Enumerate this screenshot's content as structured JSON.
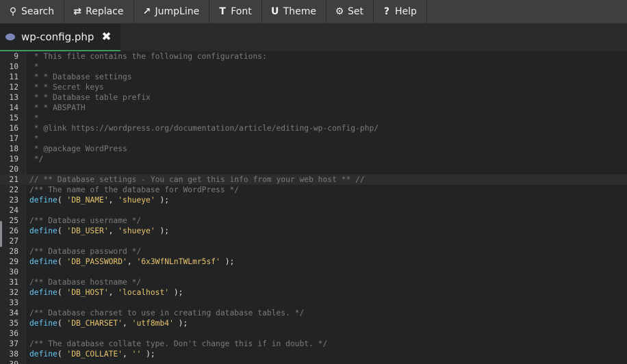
{
  "toolbar": [
    {
      "id": "search",
      "label": "Search",
      "icon": "search-icon",
      "glyph": "⚲"
    },
    {
      "id": "replace",
      "label": "Replace",
      "icon": "replace-icon",
      "glyph": "⇄"
    },
    {
      "id": "jumpline",
      "label": "JumpLine",
      "icon": "jump-icon",
      "glyph": "↗"
    },
    {
      "id": "font",
      "label": "Font",
      "icon": "font-icon",
      "glyph": "T"
    },
    {
      "id": "theme",
      "label": "Theme",
      "icon": "theme-icon",
      "glyph": "U"
    },
    {
      "id": "set",
      "label": "Set",
      "icon": "gear-icon",
      "glyph": "⚙"
    },
    {
      "id": "help",
      "label": "Help",
      "icon": "help-icon",
      "glyph": "?"
    }
  ],
  "tab": {
    "filename": "wp-config.php",
    "close_glyph": "✖"
  },
  "colors": {
    "accent": "#3f9b5a",
    "keyword": "#67c8f3",
    "string": "#e8c56b",
    "comment": "#7c7c7c"
  },
  "editor": {
    "active_line": 21,
    "lines": [
      {
        "n": "9",
        "parts": [
          {
            "t": " * This file contains the following configurations:",
            "c": "cm"
          }
        ]
      },
      {
        "n": "10",
        "parts": [
          {
            "t": " *",
            "c": "cm"
          }
        ]
      },
      {
        "n": "11",
        "parts": [
          {
            "t": " * * Database settings",
            "c": "cm"
          }
        ]
      },
      {
        "n": "12",
        "parts": [
          {
            "t": " * * Secret keys",
            "c": "cm"
          }
        ]
      },
      {
        "n": "13",
        "parts": [
          {
            "t": " * * Database table prefix",
            "c": "cm"
          }
        ]
      },
      {
        "n": "14",
        "parts": [
          {
            "t": " * * ABSPATH",
            "c": "cm"
          }
        ]
      },
      {
        "n": "15",
        "parts": [
          {
            "t": " *",
            "c": "cm"
          }
        ]
      },
      {
        "n": "16",
        "parts": [
          {
            "t": " * @link https://wordpress.org/documentation/article/editing-wp-config-php/",
            "c": "cm"
          }
        ]
      },
      {
        "n": "17",
        "parts": [
          {
            "t": " *",
            "c": "cm"
          }
        ]
      },
      {
        "n": "18",
        "parts": [
          {
            "t": " * @package WordPress",
            "c": "cm"
          }
        ]
      },
      {
        "n": "19",
        "parts": [
          {
            "t": " */",
            "c": "cm"
          }
        ]
      },
      {
        "n": "20",
        "parts": []
      },
      {
        "n": "21",
        "parts": [
          {
            "t": "// ** Database settings - You can get this info from your web host ** //",
            "c": "cm"
          }
        ]
      },
      {
        "n": "22",
        "parts": [
          {
            "t": "/** The name of the database for WordPress */",
            "c": "cm"
          }
        ]
      },
      {
        "n": "23",
        "parts": [
          {
            "t": "define",
            "c": "kw"
          },
          {
            "t": "( ",
            "c": "pn"
          },
          {
            "t": "'DB_NAME'",
            "c": "st"
          },
          {
            "t": ", ",
            "c": "pn"
          },
          {
            "t": "'shueye'",
            "c": "st"
          },
          {
            "t": " );",
            "c": "pn"
          }
        ]
      },
      {
        "n": "24",
        "parts": []
      },
      {
        "n": "25",
        "parts": [
          {
            "t": "/** Database username */",
            "c": "cm"
          }
        ]
      },
      {
        "n": "26",
        "parts": [
          {
            "t": "define",
            "c": "kw"
          },
          {
            "t": "( ",
            "c": "pn"
          },
          {
            "t": "'DB_USER'",
            "c": "st"
          },
          {
            "t": ", ",
            "c": "pn"
          },
          {
            "t": "'shueye'",
            "c": "st"
          },
          {
            "t": " );",
            "c": "pn"
          }
        ]
      },
      {
        "n": "27",
        "parts": []
      },
      {
        "n": "28",
        "parts": [
          {
            "t": "/** Database password */",
            "c": "cm"
          }
        ]
      },
      {
        "n": "29",
        "parts": [
          {
            "t": "define",
            "c": "kw"
          },
          {
            "t": "( ",
            "c": "pn"
          },
          {
            "t": "'DB_PASSWORD'",
            "c": "st"
          },
          {
            "t": ", ",
            "c": "pn"
          },
          {
            "t": "'6x3WfNLnTWLmr5sf'",
            "c": "st"
          },
          {
            "t": " );",
            "c": "pn"
          }
        ]
      },
      {
        "n": "30",
        "parts": []
      },
      {
        "n": "31",
        "parts": [
          {
            "t": "/** Database hostname */",
            "c": "cm"
          }
        ]
      },
      {
        "n": "32",
        "parts": [
          {
            "t": "define",
            "c": "kw"
          },
          {
            "t": "( ",
            "c": "pn"
          },
          {
            "t": "'DB_HOST'",
            "c": "st"
          },
          {
            "t": ", ",
            "c": "pn"
          },
          {
            "t": "'localhost'",
            "c": "st"
          },
          {
            "t": " );",
            "c": "pn"
          }
        ]
      },
      {
        "n": "33",
        "parts": []
      },
      {
        "n": "34",
        "parts": [
          {
            "t": "/** Database charset to use in creating database tables. */",
            "c": "cm"
          }
        ]
      },
      {
        "n": "35",
        "parts": [
          {
            "t": "define",
            "c": "kw"
          },
          {
            "t": "( ",
            "c": "pn"
          },
          {
            "t": "'DB_CHARSET'",
            "c": "st"
          },
          {
            "t": ", ",
            "c": "pn"
          },
          {
            "t": "'utf8mb4'",
            "c": "st"
          },
          {
            "t": " );",
            "c": "pn"
          }
        ]
      },
      {
        "n": "36",
        "parts": []
      },
      {
        "n": "37",
        "parts": [
          {
            "t": "/** The database collate type. Don't change this if in doubt. */",
            "c": "cm"
          }
        ]
      },
      {
        "n": "38",
        "parts": [
          {
            "t": "define",
            "c": "kw"
          },
          {
            "t": "( ",
            "c": "pn"
          },
          {
            "t": "'DB_COLLATE'",
            "c": "st"
          },
          {
            "t": ", ",
            "c": "pn"
          },
          {
            "t": "''",
            "c": "st"
          },
          {
            "t": " );",
            "c": "pn"
          }
        ]
      },
      {
        "n": "39",
        "parts": []
      }
    ]
  }
}
